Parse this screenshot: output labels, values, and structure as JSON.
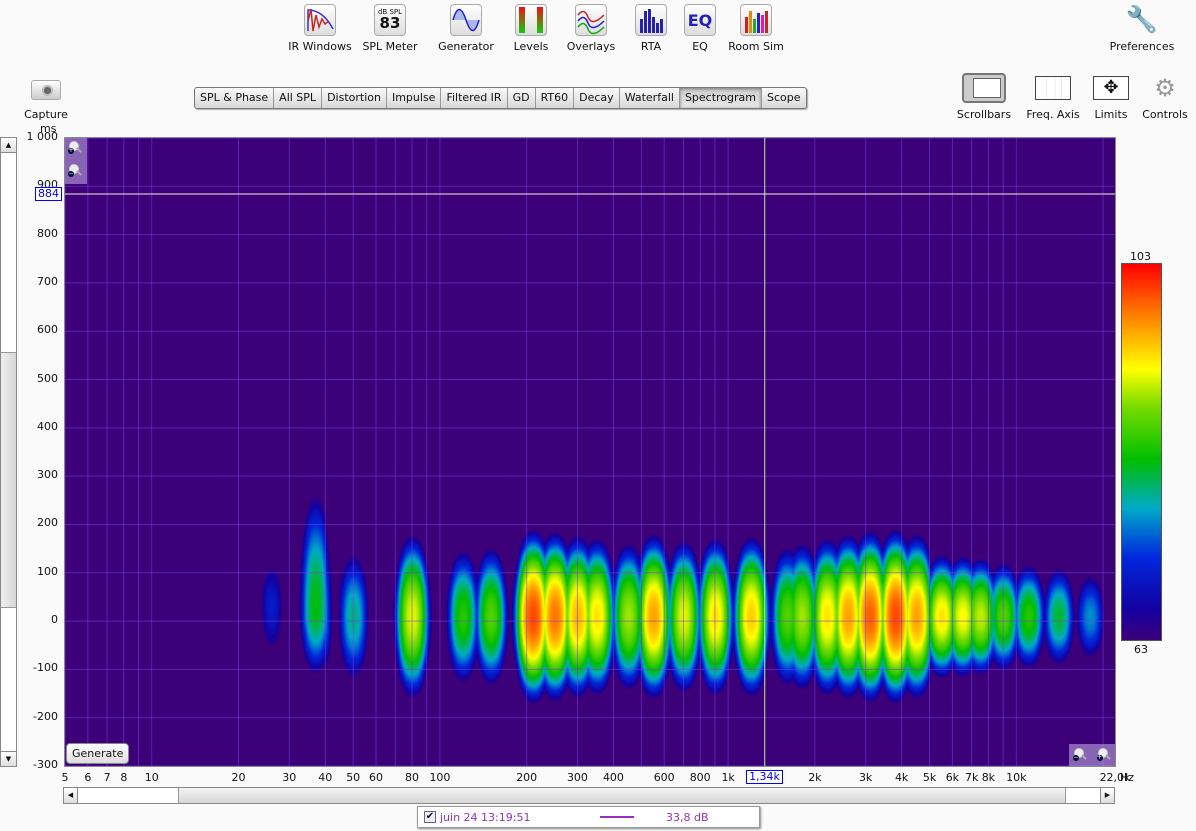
{
  "toolbar": {
    "items": [
      {
        "label": "IR Windows",
        "icon": "ir-windows-icon"
      },
      {
        "label": "SPL Meter",
        "icon": "spl-meter-icon",
        "badge_top": "dB SPL",
        "badge_value": "83"
      },
      {
        "label": "Generator",
        "icon": "generator-icon"
      },
      {
        "label": "Levels",
        "icon": "levels-icon"
      },
      {
        "label": "Overlays",
        "icon": "overlays-icon"
      },
      {
        "label": "RTA",
        "icon": "rta-icon"
      },
      {
        "label": "EQ",
        "icon": "eq-icon",
        "glyph": "EQ"
      },
      {
        "label": "Room Sim",
        "icon": "room-sim-icon"
      }
    ],
    "preferences": "Preferences",
    "capture": "Capture"
  },
  "tabs": [
    "SPL & Phase",
    "All SPL",
    "Distortion",
    "Impulse",
    "Filtered IR",
    "GD",
    "RT60",
    "Decay",
    "Waterfall",
    "Spectrogram",
    "Scope"
  ],
  "active_tab": "Spectrogram",
  "view_controls": [
    "Scrollbars",
    "Freq. Axis",
    "Limits",
    "Controls"
  ],
  "generate_button": "Generate",
  "legend": {
    "checked": true,
    "name": "juin 24 13:19:51",
    "value": "33,8 dB",
    "color": "#9a2fc0"
  },
  "chart_data": {
    "type": "heatmap",
    "ylabel": "ms",
    "xunit": "Hz",
    "xscale": "log",
    "xlim": [
      5,
      22000
    ],
    "ylim": [
      -300,
      1000
    ],
    "y_ticks": [
      "1 000",
      "900",
      "800",
      "700",
      "600",
      "500",
      "400",
      "300",
      "200",
      "100",
      "0",
      "-100",
      "-200",
      "-300"
    ],
    "x_ticks": [
      {
        "v": 5,
        "t": "5"
      },
      {
        "v": 6,
        "t": "6"
      },
      {
        "v": 7,
        "t": "7"
      },
      {
        "v": 8,
        "t": "8"
      },
      {
        "v": 10,
        "t": "10"
      },
      {
        "v": 20,
        "t": "20"
      },
      {
        "v": 30,
        "t": "30"
      },
      {
        "v": 40,
        "t": "40"
      },
      {
        "v": 50,
        "t": "50"
      },
      {
        "v": 60,
        "t": "60"
      },
      {
        "v": 80,
        "t": "80"
      },
      {
        "v": 100,
        "t": "100"
      },
      {
        "v": 200,
        "t": "200"
      },
      {
        "v": 300,
        "t": "300"
      },
      {
        "v": 400,
        "t": "400"
      },
      {
        "v": 600,
        "t": "600"
      },
      {
        "v": 800,
        "t": "800"
      },
      {
        "v": 1000,
        "t": "1k"
      },
      {
        "v": 2000,
        "t": "2k"
      },
      {
        "v": 3000,
        "t": "3k"
      },
      {
        "v": 4000,
        "t": "4k"
      },
      {
        "v": 5000,
        "t": "5k"
      },
      {
        "v": 6000,
        "t": "6k"
      },
      {
        "v": 7000,
        "t": "7k"
      },
      {
        "v": 8000,
        "t": "8k"
      },
      {
        "v": 10000,
        "t": "10k"
      },
      {
        "v": 22000,
        "t": "22,0k"
      }
    ],
    "grid": true,
    "colorscale": {
      "min": 63,
      "max": 103,
      "min_label": "63",
      "max_label": "103"
    },
    "cursor": {
      "freq": 1340,
      "freq_label": "1,34k",
      "time": 884,
      "time_label": "884"
    },
    "peaks_db": [
      [
        26,
        70
      ],
      [
        37,
        82
      ],
      [
        50,
        79
      ],
      [
        80,
        91
      ],
      [
        120,
        84
      ],
      [
        150,
        86
      ],
      [
        210,
        100
      ],
      [
        250,
        98
      ],
      [
        300,
        95
      ],
      [
        350,
        93
      ],
      [
        450,
        89
      ],
      [
        550,
        96
      ],
      [
        700,
        91
      ],
      [
        900,
        93
      ],
      [
        1200,
        94
      ],
      [
        1600,
        86
      ],
      [
        1800,
        89
      ],
      [
        2200,
        93
      ],
      [
        2600,
        96
      ],
      [
        3100,
        99
      ],
      [
        3800,
        100
      ],
      [
        4500,
        96
      ],
      [
        5500,
        93
      ],
      [
        6500,
        92
      ],
      [
        7500,
        90
      ],
      [
        9000,
        86
      ],
      [
        11000,
        84
      ],
      [
        14000,
        81
      ],
      [
        18000,
        76
      ]
    ]
  }
}
